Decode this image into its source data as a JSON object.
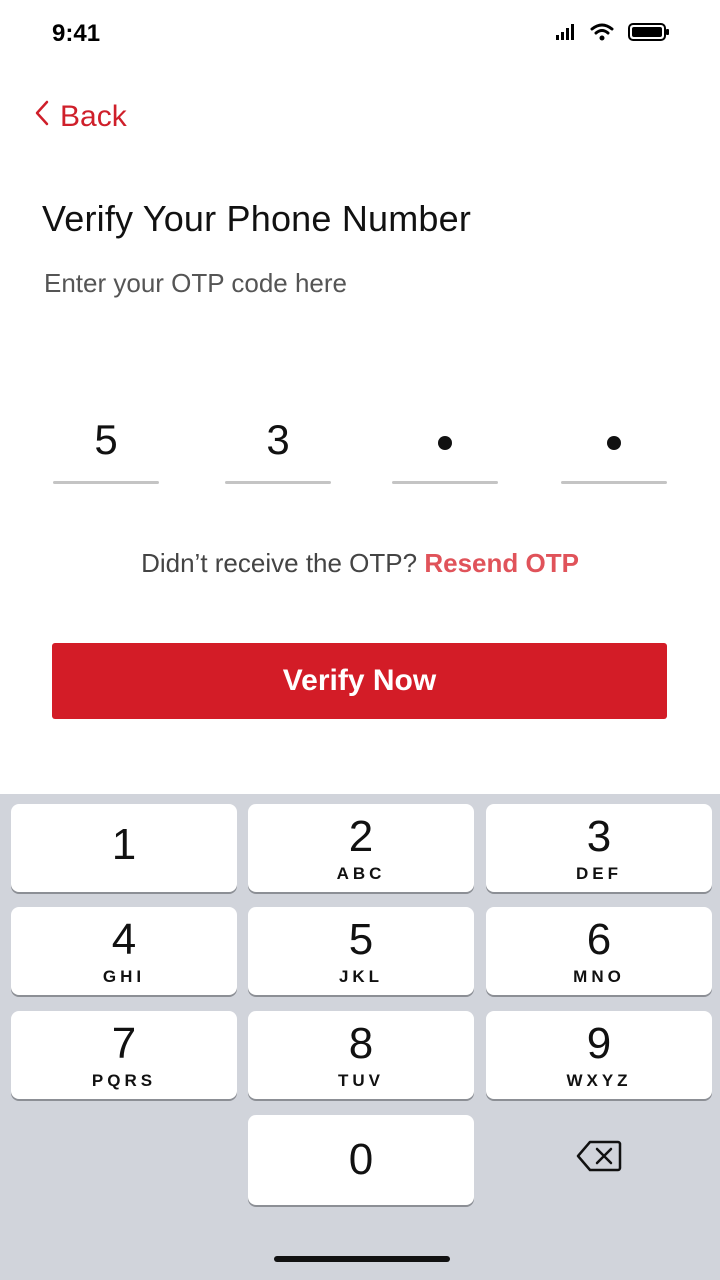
{
  "status": {
    "time": "9:41",
    "icons": [
      "signal-icon",
      "wifi-icon",
      "battery-icon"
    ]
  },
  "nav": {
    "back_label": "Back",
    "back_icon": "chevron-left-icon"
  },
  "header": {
    "title": "Verify Your Phone Number",
    "subtitle": "Enter your OTP code here"
  },
  "otp": {
    "digits": [
      "5",
      "3",
      "",
      ""
    ],
    "masked": [
      false,
      false,
      true,
      true
    ]
  },
  "resend": {
    "prompt": "Didn’t receive the OTP?",
    "link": "Resend OTP"
  },
  "actions": {
    "verify_label": "Verify Now"
  },
  "keyboard": {
    "keys": [
      {
        "num": "1",
        "letters": ""
      },
      {
        "num": "2",
        "letters": "ABC"
      },
      {
        "num": "3",
        "letters": "DEF"
      },
      {
        "num": "4",
        "letters": "GHI"
      },
      {
        "num": "5",
        "letters": "JKL"
      },
      {
        "num": "6",
        "letters": "MNO"
      },
      {
        "num": "7",
        "letters": "PQRS"
      },
      {
        "num": "8",
        "letters": "TUV"
      },
      {
        "num": "9",
        "letters": "WXYZ"
      }
    ],
    "zero": "0",
    "backspace_icon": "backspace-icon"
  },
  "colors": {
    "accent": "#d31c27",
    "link": "#e0535a",
    "keyboard_bg": "#d1d4db"
  }
}
